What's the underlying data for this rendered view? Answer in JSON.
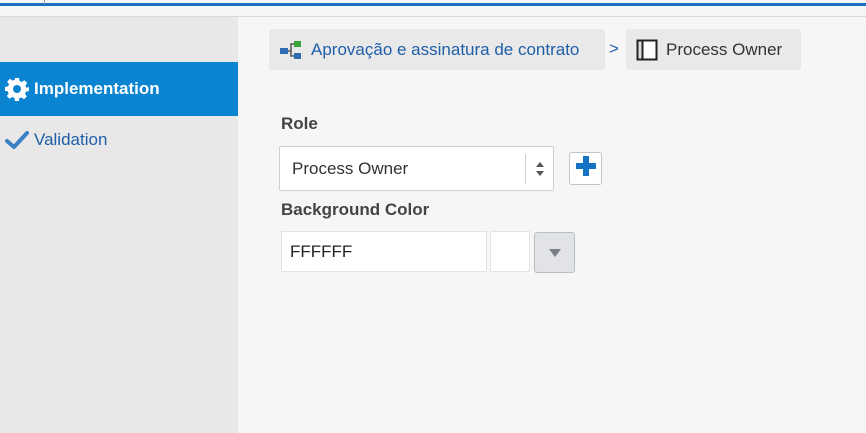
{
  "sidebar": {
    "items": [
      {
        "label": "Implementation",
        "icon": "gear-icon",
        "active": true
      },
      {
        "label": "Validation",
        "icon": "checkmark-icon",
        "active": false
      }
    ]
  },
  "breadcrumb": {
    "process_label": "Aprovação e assinatura de contrato",
    "process_icon": "process-flow-icon",
    "separator": ">",
    "role_label": "Process Owner",
    "role_icon": "swimlane-icon"
  },
  "form": {
    "role_label": "Role",
    "role_value": "Process Owner",
    "add_role_icon": "plus-icon",
    "bg_color_label": "Background Color",
    "bg_color_value": "FFFFFF",
    "bg_color_swatch": "#FFFFFF"
  },
  "colors": {
    "accent": "#0a84d0",
    "link": "#1f5fa8",
    "sidebar_bg": "#e8e8e8",
    "main_bg": "#f6f6f6"
  }
}
